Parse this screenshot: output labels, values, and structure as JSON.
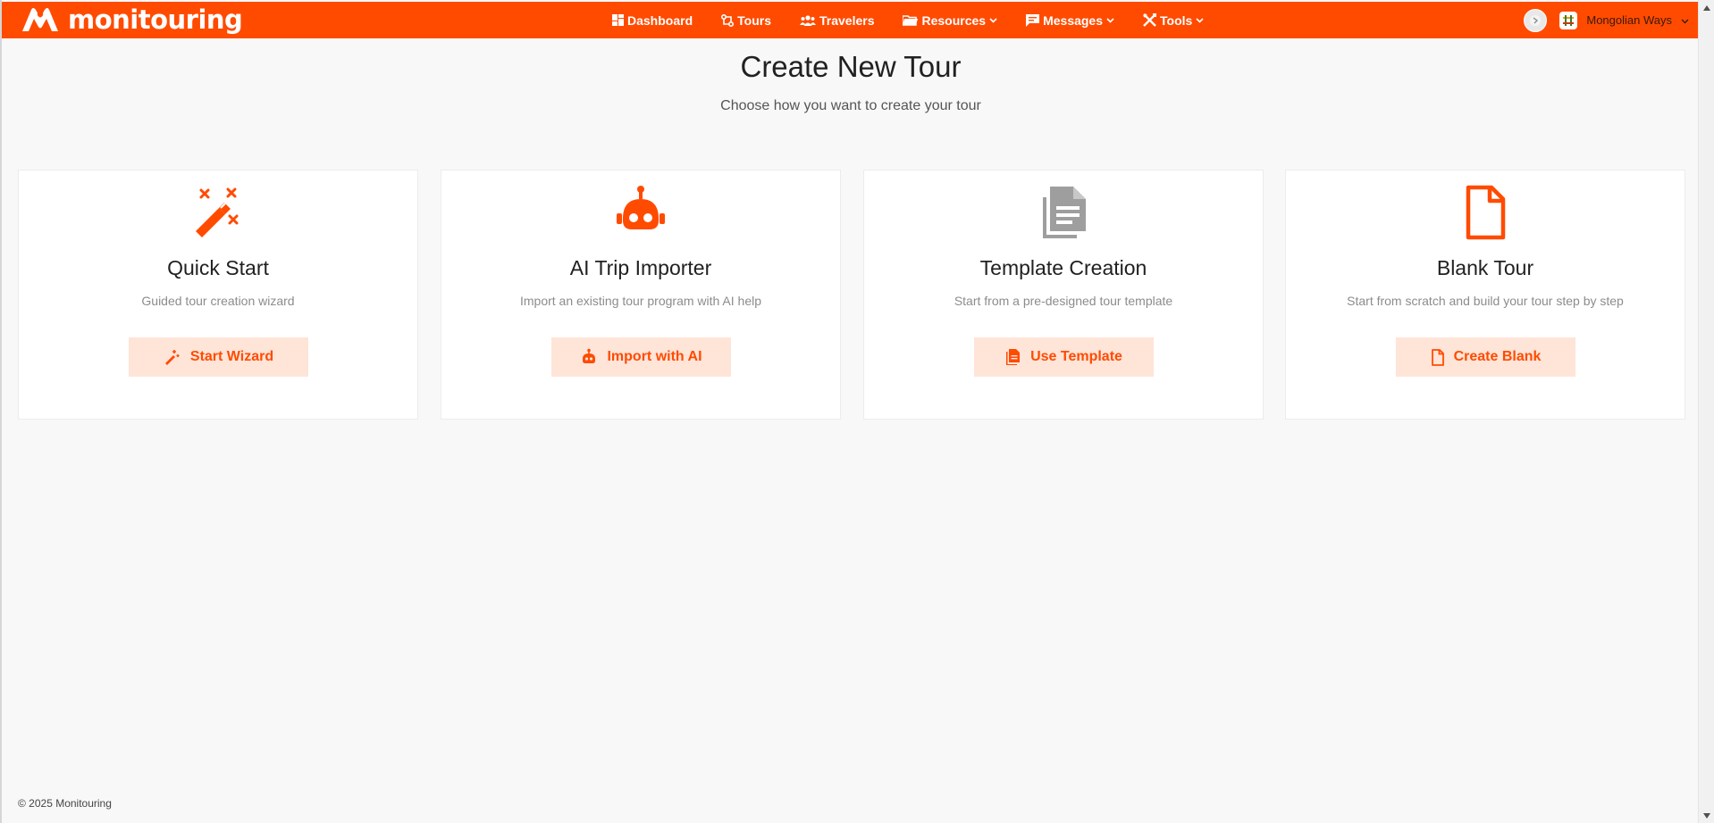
{
  "brand": {
    "name": "monitouring",
    "logo_icon": "monitouring-logo-icon"
  },
  "nav": {
    "items": [
      {
        "label": "Dashboard",
        "icon": "dashboard-icon",
        "dropdown": false
      },
      {
        "label": "Tours",
        "icon": "route-icon",
        "dropdown": false
      },
      {
        "label": "Travelers",
        "icon": "users-icon",
        "dropdown": false
      },
      {
        "label": "Resources",
        "icon": "folder-icon",
        "dropdown": true
      },
      {
        "label": "Messages",
        "icon": "message-icon",
        "dropdown": true
      },
      {
        "label": "Tools",
        "icon": "tools-icon",
        "dropdown": true
      }
    ],
    "org_name": "Mongolian Ways"
  },
  "page": {
    "title": "Create New Tour",
    "subtitle": "Choose how you want to create your tour"
  },
  "cards": [
    {
      "title": "Quick Start",
      "description": "Guided tour creation wizard",
      "button": "Start Wizard",
      "icon": "magic-wand-icon"
    },
    {
      "title": "AI Trip Importer",
      "description": "Import an existing tour program with AI help",
      "button": "Import with AI",
      "icon": "robot-icon"
    },
    {
      "title": "Template Creation",
      "description": "Start from a pre-designed tour template",
      "button": "Use Template",
      "icon": "document-copy-icon"
    },
    {
      "title": "Blank Tour",
      "description": "Start from scratch and build your tour step by step",
      "button": "Create Blank",
      "icon": "blank-file-icon"
    }
  ],
  "footer": {
    "copyright": "© 2025 Monitouring"
  },
  "colors": {
    "accent": "#ff4b00",
    "button_bg": "#ffe4d8",
    "template_icon": "#9e9e9e"
  }
}
